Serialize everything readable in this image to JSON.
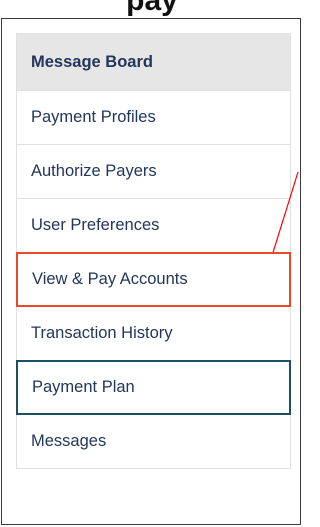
{
  "caption": "pay",
  "menu": {
    "items": [
      {
        "label": "Message Board"
      },
      {
        "label": "Payment Profiles"
      },
      {
        "label": "Authorize Payers"
      },
      {
        "label": "User Preferences"
      },
      {
        "label": "View & Pay Accounts"
      },
      {
        "label": "Transaction History"
      },
      {
        "label": "Payment Plan"
      },
      {
        "label": "Messages"
      }
    ]
  },
  "colors": {
    "highlight_red": "#ec4a24",
    "highlight_teal": "#1c4f60",
    "arrow": "#ff0000",
    "link_text": "#23365b",
    "active_bg": "#e6e6e6"
  }
}
